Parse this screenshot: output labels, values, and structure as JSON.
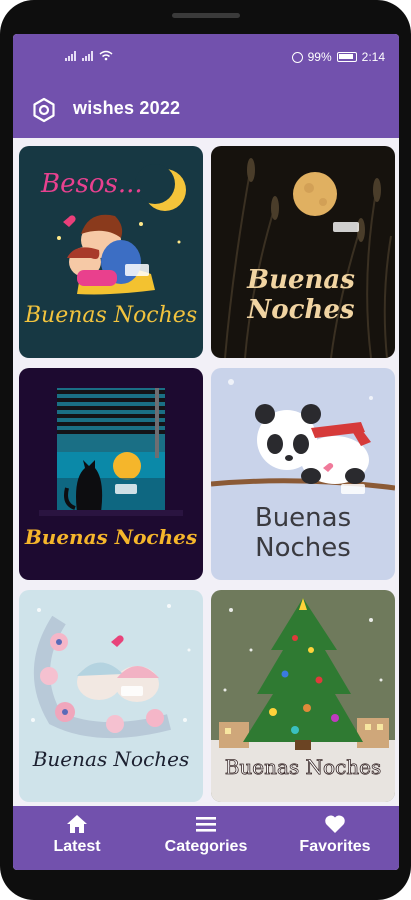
{
  "status_bar": {
    "battery": "99%",
    "time": "2:14"
  },
  "app_bar": {
    "title": "wishes 2022",
    "settings_icon": "gear-icon"
  },
  "cards": [
    {
      "top_text": "Besos...",
      "main_text": "Buenas Noches"
    },
    {
      "line1": "Buenas",
      "line2": "Noches"
    },
    {
      "main_text": "Buenas Noches"
    },
    {
      "line1": "Buenas",
      "line2": "Noches"
    },
    {
      "main_text": "Buenas Noches"
    },
    {
      "main_text": "Buenas Noches"
    }
  ],
  "bottom_nav": [
    {
      "label": "Latest",
      "icon": "home-icon"
    },
    {
      "label": "Categories",
      "icon": "menu-icon"
    },
    {
      "label": "Favorites",
      "icon": "heart-icon"
    }
  ],
  "colors": {
    "primary": "#7251ad",
    "white": "#ffffff"
  }
}
